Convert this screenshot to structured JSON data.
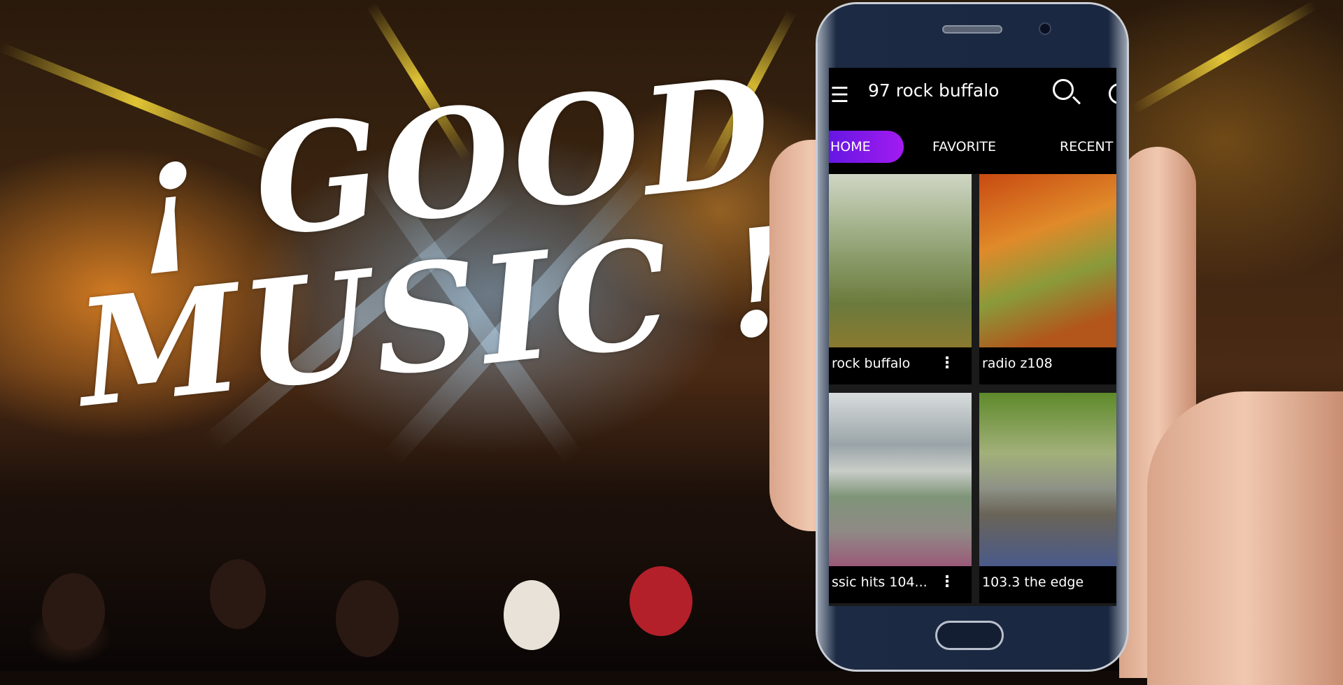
{
  "headline": {
    "line1": "¡ GOOD",
    "line2": "MUSIC !"
  },
  "app": {
    "title": "97 rock buffalo",
    "icons": {
      "menu": "hamburger-icon",
      "search": "search-icon",
      "more": "circle-icon"
    },
    "tabs": [
      {
        "label": "HOME",
        "active": true
      },
      {
        "label": "FAVORITE"
      },
      {
        "label": "RECENT"
      }
    ],
    "accent": "#8a1cf0",
    "stations": [
      {
        "name": "rock buffalo",
        "has_menu": true
      },
      {
        "name": "radio z108",
        "has_menu": false
      },
      {
        "name": "ssic hits 104...",
        "has_menu": true
      },
      {
        "name": "103.3 the edge",
        "has_menu": false
      }
    ]
  }
}
